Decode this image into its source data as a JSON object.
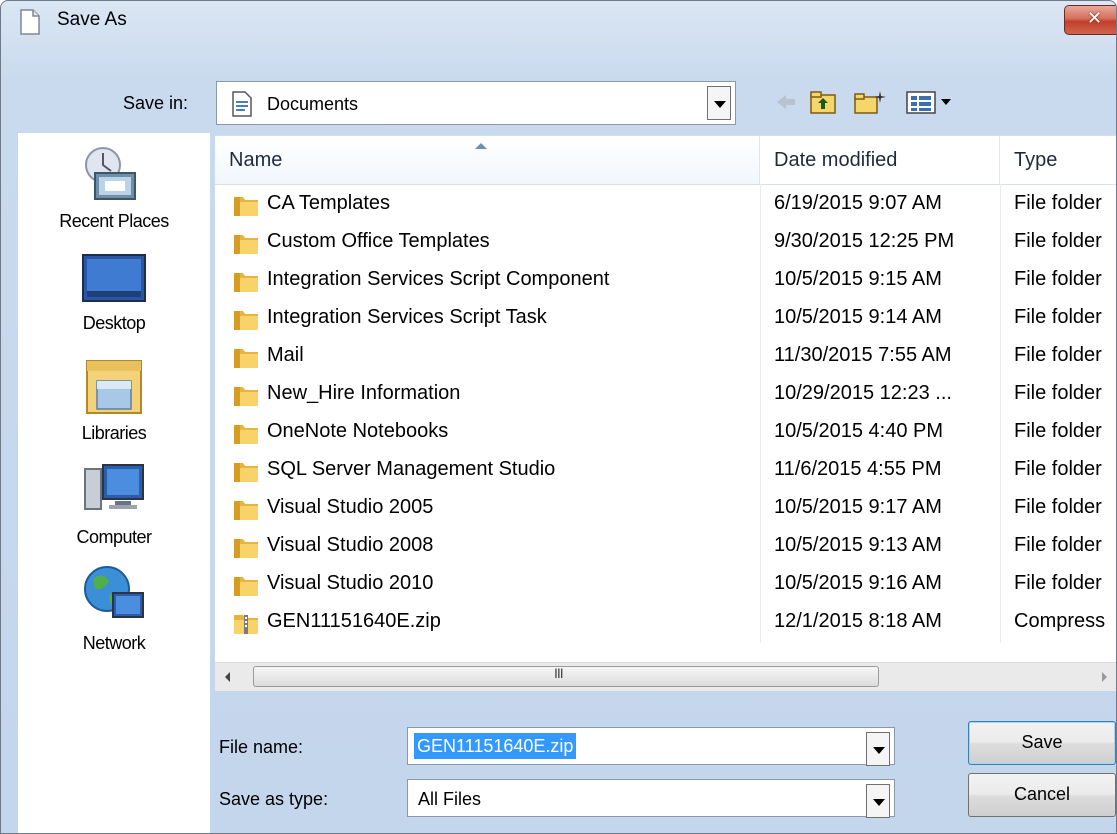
{
  "window": {
    "title": "Save As",
    "close_glyph": "✕"
  },
  "toolbar": {
    "save_in_label": "Save in:",
    "save_in_value": "Documents",
    "icons": [
      "back-arrow-icon",
      "up-folder-icon",
      "new-folder-icon",
      "view-menu-icon"
    ]
  },
  "places": [
    {
      "label": "Recent Places",
      "icon": "recent-places-icon"
    },
    {
      "label": "Desktop",
      "icon": "desktop-icon"
    },
    {
      "label": "Libraries",
      "icon": "libraries-icon"
    },
    {
      "label": "Computer",
      "icon": "computer-icon"
    },
    {
      "label": "Network",
      "icon": "network-icon"
    }
  ],
  "file_list": {
    "columns": {
      "name": "Name",
      "date": "Date modified",
      "type": "Type"
    },
    "sort": {
      "column": "name",
      "direction": "ascending"
    },
    "rows": [
      {
        "name": "CA Templates",
        "date": "6/19/2015 9:07 AM",
        "type": "File folder",
        "icon": "folder-icon"
      },
      {
        "name": "Custom Office Templates",
        "date": "9/30/2015 12:25 PM",
        "type": "File folder",
        "icon": "folder-icon"
      },
      {
        "name": "Integration Services Script Component",
        "date": "10/5/2015 9:15 AM",
        "type": "File folder",
        "icon": "folder-icon"
      },
      {
        "name": "Integration Services Script Task",
        "date": "10/5/2015 9:14 AM",
        "type": "File folder",
        "icon": "folder-icon"
      },
      {
        "name": "Mail",
        "date": "11/30/2015 7:55 AM",
        "type": "File folder",
        "icon": "folder-icon"
      },
      {
        "name": "New_Hire Information",
        "date": "10/29/2015 12:23 ...",
        "type": "File folder",
        "icon": "folder-icon"
      },
      {
        "name": "OneNote Notebooks",
        "date": "10/5/2015 4:40 PM",
        "type": "File folder",
        "icon": "folder-icon"
      },
      {
        "name": "SQL Server Management Studio",
        "date": "11/6/2015 4:55 PM",
        "type": "File folder",
        "icon": "folder-icon"
      },
      {
        "name": "Visual Studio 2005",
        "date": "10/5/2015 9:17 AM",
        "type": "File folder",
        "icon": "folder-icon"
      },
      {
        "name": "Visual Studio 2008",
        "date": "10/5/2015 9:13 AM",
        "type": "File folder",
        "icon": "folder-icon"
      },
      {
        "name": "Visual Studio 2010",
        "date": "10/5/2015 9:16 AM",
        "type": "File folder",
        "icon": "folder-icon"
      },
      {
        "name": "GEN11151640E.zip",
        "date": "12/1/2015 8:18 AM",
        "type": "Compress",
        "icon": "zip-folder-icon"
      }
    ],
    "scrollbar_grip": "III"
  },
  "fields": {
    "file_name_label": "File name:",
    "file_name_value": "GEN11151640E.zip",
    "save_as_type_label": "Save as type:",
    "save_as_type_value": "All Files"
  },
  "buttons": {
    "save": "Save",
    "cancel": "Cancel"
  },
  "colors": {
    "selection": "#3399ff",
    "window_frame": "#c4d6ec",
    "close_button": "#c7402a"
  }
}
